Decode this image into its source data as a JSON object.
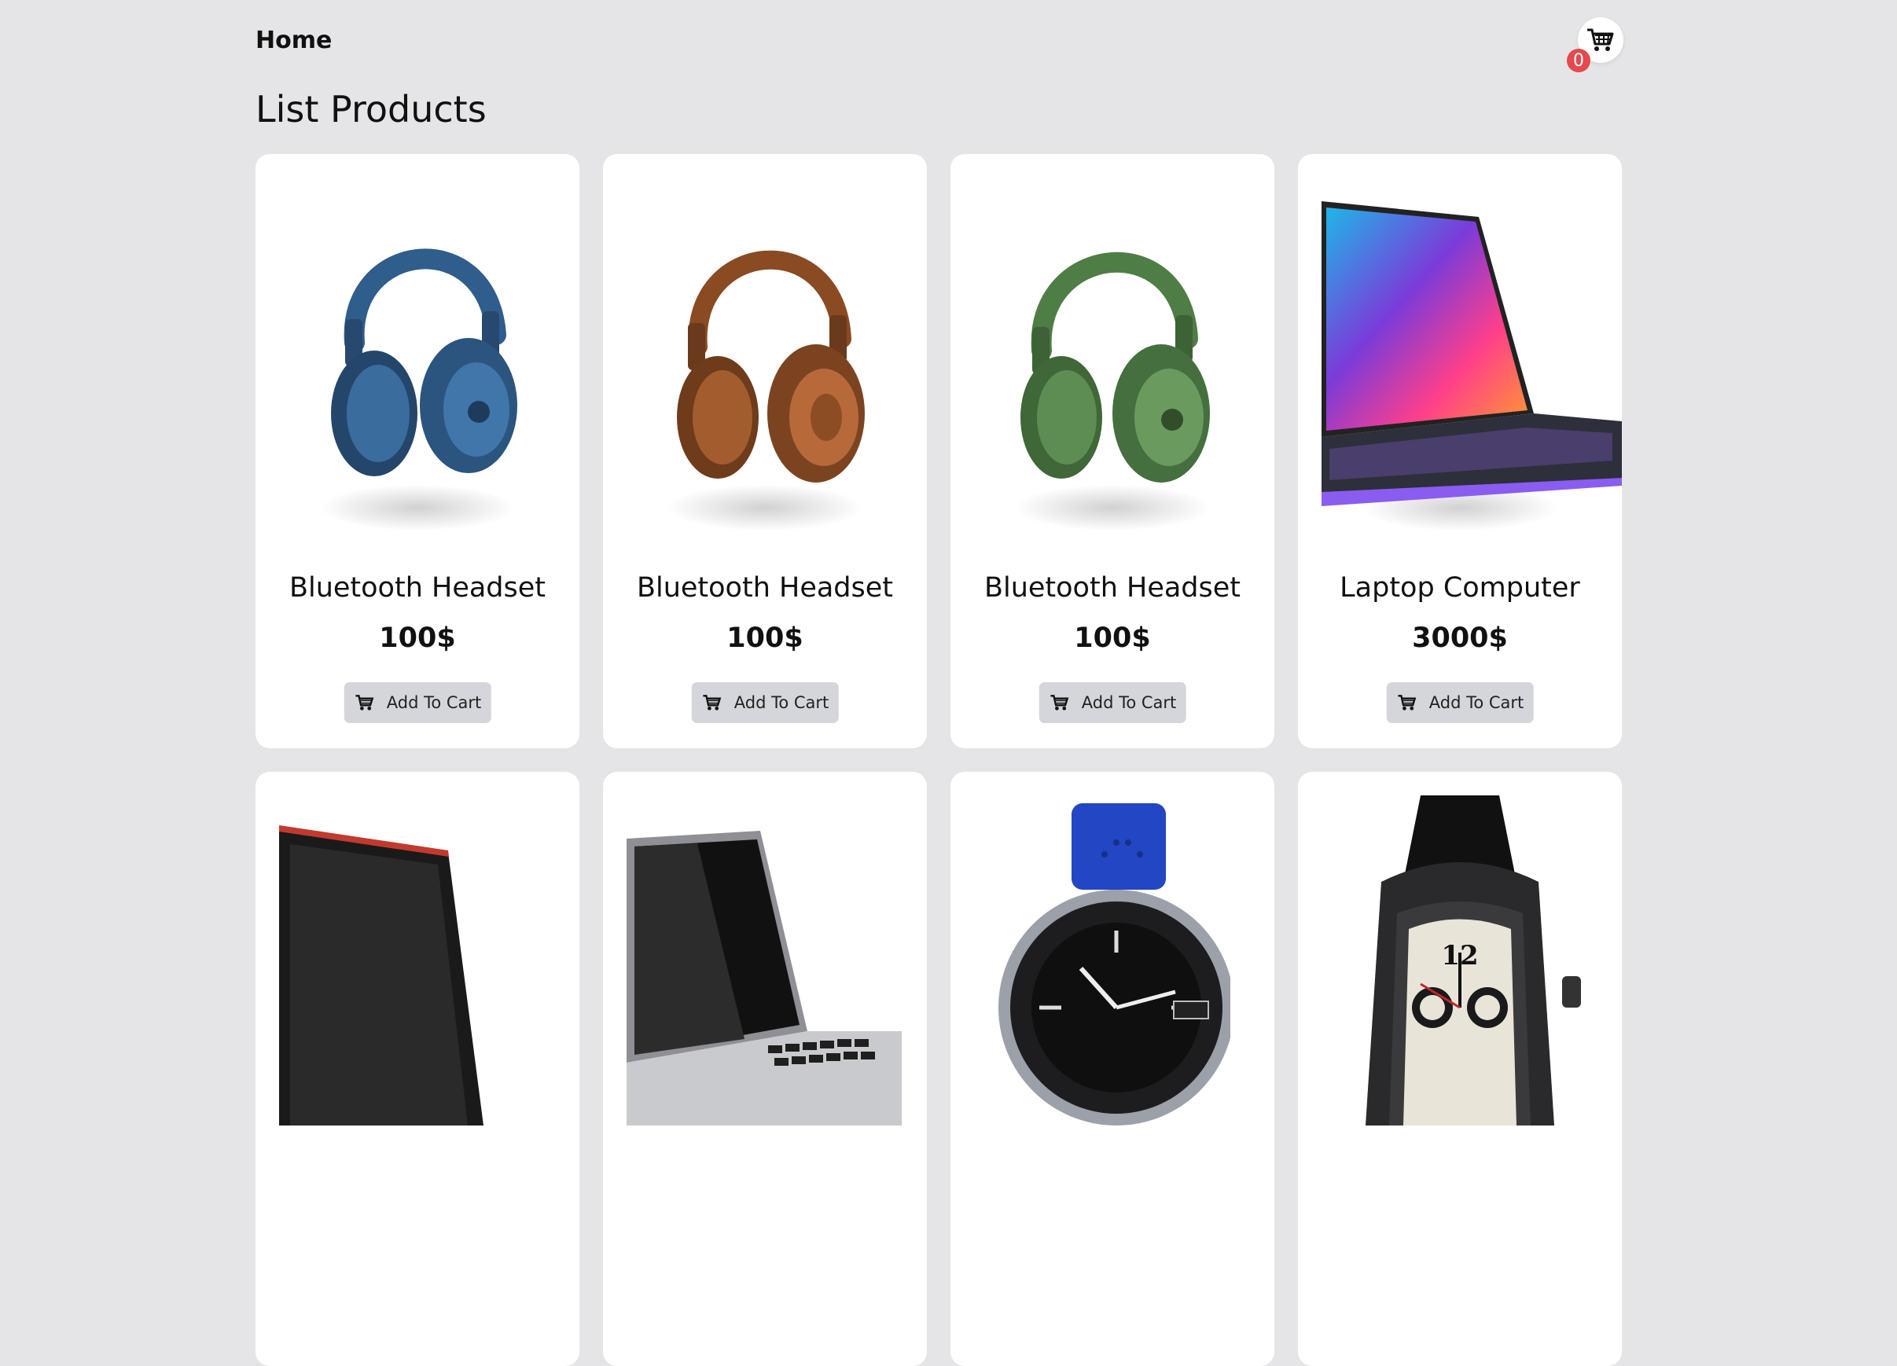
{
  "nav": {
    "home_label": "Home",
    "cart_count": "0",
    "cart_icon": "cart-icon"
  },
  "page": {
    "title": "List Products"
  },
  "button": {
    "add_to_cart_label": "Add To Cart"
  },
  "products": [
    {
      "name": "Bluetooth Headset",
      "price": "100$",
      "image": "headset-blue",
      "color": "#2f5d8c"
    },
    {
      "name": "Bluetooth Headset",
      "price": "100$",
      "image": "headset-brown",
      "color": "#9a5428"
    },
    {
      "name": "Bluetooth Headset",
      "price": "100$",
      "image": "headset-green",
      "color": "#4f7d46"
    },
    {
      "name": "Laptop Computer",
      "price": "3000$",
      "image": "laptop-colorful",
      "color": "#d14ad6"
    },
    {
      "image": "laptop-black-red"
    },
    {
      "image": "laptop-silver"
    },
    {
      "image": "watch-blue-strap"
    },
    {
      "image": "watch-black-chronograph"
    }
  ]
}
